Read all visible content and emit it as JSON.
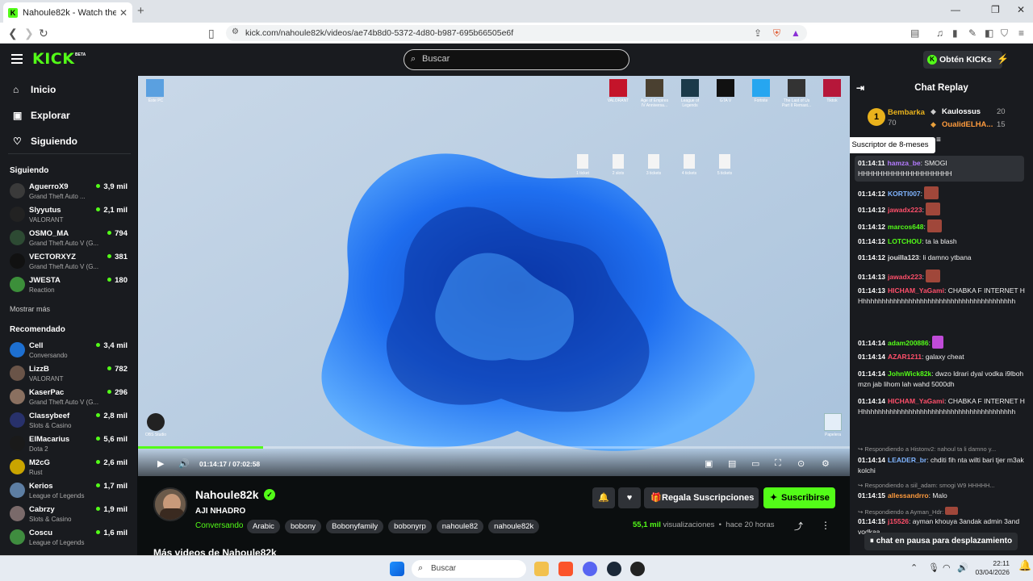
{
  "browser": {
    "tab_title": "Nahoule82k - Watch the VOD o",
    "url": "kick.com/nahoule82k/videos/ae74b8d0-5372-4d80-b987-695b66505e6f"
  },
  "header": {
    "logo": "KICK",
    "beta": "BETA",
    "search_placeholder": "Buscar",
    "get_kicks": "Obtén KICKs"
  },
  "sidebar": {
    "nav": [
      {
        "label": "Inicio",
        "icon": "home-icon"
      },
      {
        "label": "Explorar",
        "icon": "compass-icon"
      },
      {
        "label": "Siguiendo",
        "icon": "heart-icon"
      }
    ],
    "following_title": "Siguiendo",
    "following": [
      {
        "name": "AguerroX9",
        "game": "Grand Theft Auto ...",
        "viewers": "3,9 mil"
      },
      {
        "name": "Slyyutus",
        "game": "VALORANT",
        "viewers": "2,1 mil"
      },
      {
        "name": "OSMO_MA",
        "game": "Grand Theft Auto V (G...",
        "viewers": "794"
      },
      {
        "name": "VECTORXYZ",
        "game": "Grand Theft Auto V (G...",
        "viewers": "381"
      },
      {
        "name": "JWESTA",
        "game": "Reaction",
        "viewers": "180"
      }
    ],
    "show_more": "Mostrar más",
    "recommended_title": "Recomendado",
    "recommended": [
      {
        "name": "Cell",
        "game": "Conversando",
        "viewers": "3,4 mil"
      },
      {
        "name": "LizzB",
        "game": "VALORANT",
        "viewers": "782"
      },
      {
        "name": "KaserPac",
        "game": "Grand Theft Auto V (G...",
        "viewers": "296"
      },
      {
        "name": "Classybeef",
        "game": "Slots & Casino",
        "viewers": "2,8 mil"
      },
      {
        "name": "ElMacarius",
        "game": "Dota 2",
        "viewers": "5,6 mil"
      },
      {
        "name": "M2cG",
        "game": "Rust",
        "viewers": "2,6 mil"
      },
      {
        "name": "Kerios",
        "game": "League of Legends",
        "viewers": "1,7 mil"
      },
      {
        "name": "Cabrzy",
        "game": "Slots & Casino",
        "viewers": "1,9 mil"
      },
      {
        "name": "Coscu",
        "game": "League of Legends",
        "viewers": "1,6 mil"
      }
    ]
  },
  "player": {
    "current_time": "01:14:17",
    "duration": "07:02:58",
    "progress": 0.176
  },
  "stream": {
    "channel": "Nahoule82k",
    "title": "AJI NHADRO",
    "category": "Conversando",
    "tags": [
      "Arabic",
      "bobony",
      "Bobonyfamily",
      "bobonyrp",
      "nahoule82",
      "nahoule82k"
    ],
    "gift_label": "Regala Suscripciones",
    "subscribe_label": "Suscribirse",
    "views_count": "55,1 mil",
    "views_label": "visualizaciones",
    "ago": "hace 20 horas",
    "more_videos": "Más videos de Nahoule82k"
  },
  "chat": {
    "title": "Chat Replay",
    "leaderboard": [
      {
        "rank": "1",
        "name": "Bembarka",
        "score": "70"
      },
      {
        "name": "Kaulossus",
        "score": "20"
      },
      {
        "name": "OualidELHA...",
        "score": "15"
      }
    ],
    "tooltip": "Suscriptor de 8-meses",
    "messages": [
      {
        "time": "01:14:11",
        "user": "hamza_be",
        "text": "SMOGI HHHHHHHHHHHHHHHHHHH",
        "color": "#b57bff"
      },
      {
        "time": "01:14:12",
        "user": "KORTI007",
        "text": "",
        "color": "#7fb4ff"
      },
      {
        "time": "01:14:12",
        "user": "jawadx223",
        "text": "",
        "color": "#ff4f6a"
      },
      {
        "time": "01:14:12",
        "user": "marcos648",
        "text": "",
        "color": "#53fc18"
      },
      {
        "time": "01:14:12",
        "user": "LOTCHOU",
        "text": "ta la blash",
        "color": "#53fc18"
      },
      {
        "time": "01:14:12",
        "user": "jouilla123",
        "text": "li damno ytbana",
        "color": "#e0e0e0"
      },
      {
        "time": "01:14:13",
        "user": "jawadx223",
        "text": "",
        "color": "#ff4f6a"
      },
      {
        "time": "01:14:13",
        "user": "HICHAM_YaGami",
        "text": "CHABKA F INTERNET HHhhhhhhhhhhhhhhhhhhhhhhhhhhhhhhhhhhhhhhhh",
        "color": "#ff4f6a"
      },
      {
        "time": "01:14:14",
        "user": "adam200886",
        "text": "",
        "color": "#53fc18"
      },
      {
        "time": "01:14:14",
        "user": "AZAR1211",
        "text": "galaxy cheat",
        "color": "#ff4f6a"
      },
      {
        "time": "01:14:14",
        "user": "JohnWick82k",
        "text": "dwzo ldrari dyal vodka i9lboh mzn jab lihom lah wahd 5000dh",
        "color": "#53fc18"
      },
      {
        "time": "01:14:14",
        "user": "HICHAM_YaGami",
        "text": "CHABKA F INTERNET HHhhhhhhhhhhhhhhhhhhhhhhhhhhhhhhhhhhhhhhhh",
        "color": "#ff4f6a"
      },
      {
        "reply": "Respondiendo a Histonv2: nahoul ta li damno y...",
        "time": "01:14:14",
        "user": "LEADER_br",
        "text": "chditi fih nta wilti bari tjer m3ak kolchi",
        "color": "#7fb4ff"
      },
      {
        "reply": "Respondiendo a siil_adam: smogi W9 HHHHH...",
        "time": "01:14:15",
        "user": "allessandrro",
        "text": "Malo",
        "color": "#ff9b3d"
      },
      {
        "reply": "Respondiendo a Ayman_Hdr:",
        "time": "01:14:15",
        "user": "j15526",
        "text": "ayman khouya 3andak admin 3and vodkaa",
        "color": "#ff4f6a"
      }
    ],
    "paused": "chat en pausa para desplazamiento"
  },
  "desktop": {
    "top_icons": [
      "VALORANT",
      "Age of Empires IV Anniversa...",
      "League of Legends",
      "GTA V",
      "Fortnite",
      "The Last of Us Part II Remast...",
      "Tiktok"
    ],
    "files": [
      "1 ticket",
      "2 slots",
      "3 tickets",
      "4 tickets",
      "5 tickets"
    ],
    "left_icon": "Este PC",
    "obs": "OBS Studio",
    "recycle": "Papelera"
  },
  "taskbar": {
    "search": "Buscar",
    "time": "22:11",
    "date": "03/04/2026"
  },
  "colors": {
    "kick_green": "#53fc18",
    "panel_bg": "#191b1f",
    "page_bg": "#0b0e0f"
  }
}
